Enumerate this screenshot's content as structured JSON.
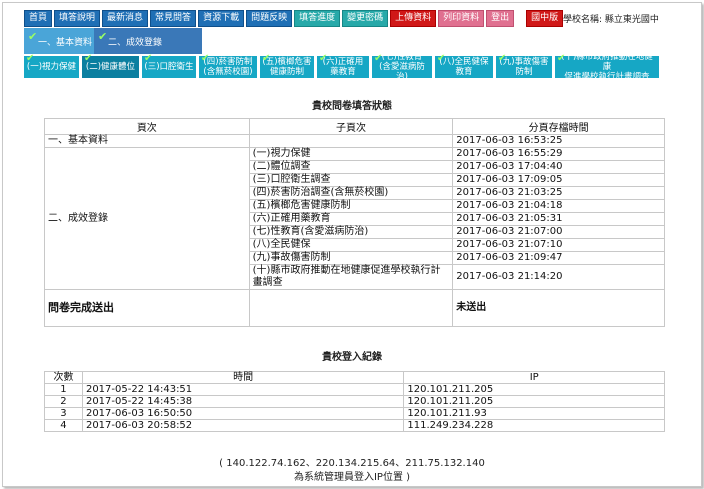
{
  "nav": [
    "首頁",
    "填答說明",
    "最新消息",
    "常見問答",
    "資源下載",
    "問題反映",
    "填答進度",
    "變更密碼",
    "上傳資料",
    "列印資料",
    "登出"
  ],
  "nav_badge": "國中版",
  "school_label": "學校名稱: 縣立東光國中",
  "steps": [
    "一、基本資料",
    "二、成效登錄"
  ],
  "subtabs": [
    "(一)視力保健",
    "(二)健康體位",
    "(三)口腔衛生",
    "(四)菸害防制\n(含無菸校園)",
    "(五)檳榔危害\n健康防制",
    "(六)正確用\n藥教育",
    "(七)性教育\n(含愛滋病防治)",
    "(八)全民健保\n教育",
    "(九)事故傷害\n防制",
    "(十)縣市政府推動在地健康\n促進學校執行計畫調查"
  ],
  "survey": {
    "title": "貴校問卷填答狀態",
    "headers": [
      "頁次",
      "子頁次",
      "分頁存檔時間"
    ],
    "basic": {
      "page": "一、基本資料",
      "time": "2017-06-03 16:53:25"
    },
    "effect_page": "二、成效登錄",
    "rows": [
      {
        "sub": "(一)視力保健",
        "time": "2017-06-03 16:55:29"
      },
      {
        "sub": "(二)體位調查",
        "time": "2017-06-03 17:04:40"
      },
      {
        "sub": "(三)口腔衛生調查",
        "time": "2017-06-03 17:09:05"
      },
      {
        "sub": "(四)菸害防治調查(含無菸校園)",
        "time": "2017-06-03 21:03:25"
      },
      {
        "sub": "(五)檳榔危害健康防制",
        "time": "2017-06-03 21:04:18"
      },
      {
        "sub": "(六)正確用藥教育",
        "time": "2017-06-03 21:05:31"
      },
      {
        "sub": "(七)性教育(含愛滋病防治)",
        "time": "2017-06-03 21:07:00"
      },
      {
        "sub": "(八)全民健保",
        "time": "2017-06-03 21:07:10"
      },
      {
        "sub": "(九)事故傷害防制",
        "time": "2017-06-03 21:09:47"
      },
      {
        "sub": "(十)縣市政府推動在地健康促進學校執行計畫調查",
        "time": "2017-06-03 21:14:20"
      }
    ],
    "submit_label": "問卷完成送出",
    "submit_status": "未送出"
  },
  "login": {
    "title": "貴校登入紀錄",
    "headers": [
      "次數",
      "時間",
      "IP"
    ],
    "rows": [
      {
        "n": "1",
        "time": "2017-05-22 14:43:51",
        "ip": "120.101.211.205"
      },
      {
        "n": "2",
        "time": "2017-05-22 14:45:38",
        "ip": "120.101.211.205"
      },
      {
        "n": "3",
        "time": "2017-06-03 16:50:50",
        "ip": "120.101.211.93"
      },
      {
        "n": "4",
        "time": "2017-06-03 20:58:52",
        "ip": "111.249.234.228"
      }
    ]
  },
  "footer_ips": "( 140.122.74.162、220.134.215.64、211.75.132.140",
  "footer_note": "為系統管理員登入IP位置 )"
}
